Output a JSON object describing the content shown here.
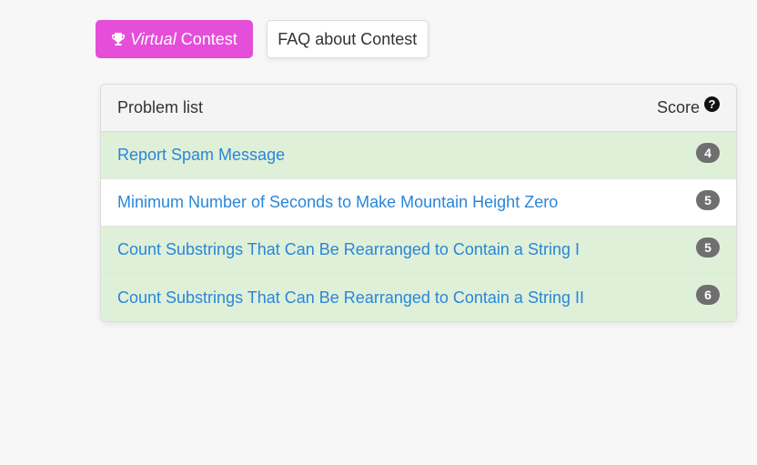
{
  "buttons": {
    "virtual": {
      "icon": "trophy-icon",
      "italic": "Virtual",
      "text": "Contest",
      "color": "#e54ed8"
    },
    "faq": {
      "label": "FAQ about Contest"
    }
  },
  "problem_list": {
    "header": {
      "title": "Problem list",
      "score_label": "Score",
      "help_icon": "question-circle-icon",
      "help_glyph": "?"
    },
    "problems": [
      {
        "title": "Report Spam Message",
        "score": "4",
        "status": "solved"
      },
      {
        "title": "Minimum Number of Seconds to Make Mountain Height Zero",
        "score": "5",
        "status": "unsolved"
      },
      {
        "title": "Count Substrings That Can Be Rearranged to Contain a String I",
        "score": "5",
        "status": "solved"
      },
      {
        "title": "Count Substrings That Can Be Rearranged to Contain a String II",
        "score": "6",
        "status": "solved"
      }
    ],
    "colors": {
      "solved_row": "#dff0d8",
      "link": "#2a86d8",
      "badge": "#6f6f6f"
    }
  }
}
